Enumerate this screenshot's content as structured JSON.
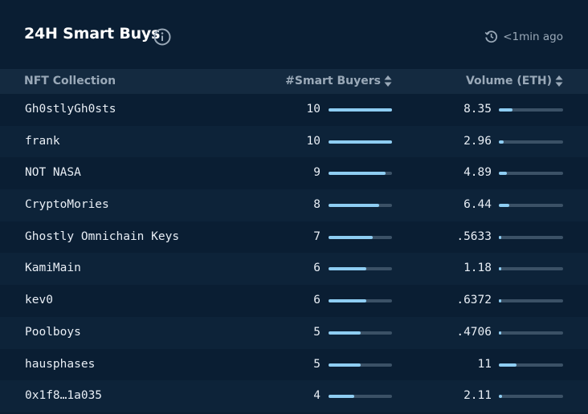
{
  "header": {
    "title": "24H Smart Buys",
    "updated": "<1min ago"
  },
  "table": {
    "columns": [
      "NFT Collection",
      "#Smart Buyers",
      "Volume (ETH)"
    ],
    "buyers_max": 10,
    "volume_max": 40,
    "rows": [
      {
        "name": "Gh0stlyGh0sts",
        "buyers": "10",
        "buyers_value": 10,
        "volume": "8.35",
        "volume_value": 8.35
      },
      {
        "name": "frank",
        "buyers": "10",
        "buyers_value": 10,
        "volume": "2.96",
        "volume_value": 2.96
      },
      {
        "name": "NOT NASA",
        "buyers": "9",
        "buyers_value": 9,
        "volume": "4.89",
        "volume_value": 4.89
      },
      {
        "name": "CryptoMories",
        "buyers": "8",
        "buyers_value": 8,
        "volume": "6.44",
        "volume_value": 6.44
      },
      {
        "name": "Ghostly Omnichain Keys",
        "buyers": "7",
        "buyers_value": 7,
        "volume": ".5633",
        "volume_value": 0.5633
      },
      {
        "name": "KamiMain",
        "buyers": "6",
        "buyers_value": 6,
        "volume": "1.18",
        "volume_value": 1.18
      },
      {
        "name": "kev0",
        "buyers": "6",
        "buyers_value": 6,
        "volume": ".6372",
        "volume_value": 0.6372
      },
      {
        "name": "Poolboys",
        "buyers": "5",
        "buyers_value": 5,
        "volume": ".4706",
        "volume_value": 0.4706
      },
      {
        "name": "hausphases",
        "buyers": "5",
        "buyers_value": 5,
        "volume": "11",
        "volume_value": 11
      },
      {
        "name": "0x1f8…1a035",
        "buyers": "4",
        "buyers_value": 4,
        "volume": "2.11",
        "volume_value": 2.11
      }
    ]
  },
  "icons": {
    "info": "info-icon",
    "clock": "history-clock-icon",
    "sort": "sort-icon"
  },
  "colors": {
    "background": "#0a1e33",
    "header_row": "#142a40",
    "alt_row": "#0d2339",
    "bar_fill": "#8ecdf2",
    "bar_track": "#3b5166",
    "muted_text": "#9aa9b8"
  }
}
